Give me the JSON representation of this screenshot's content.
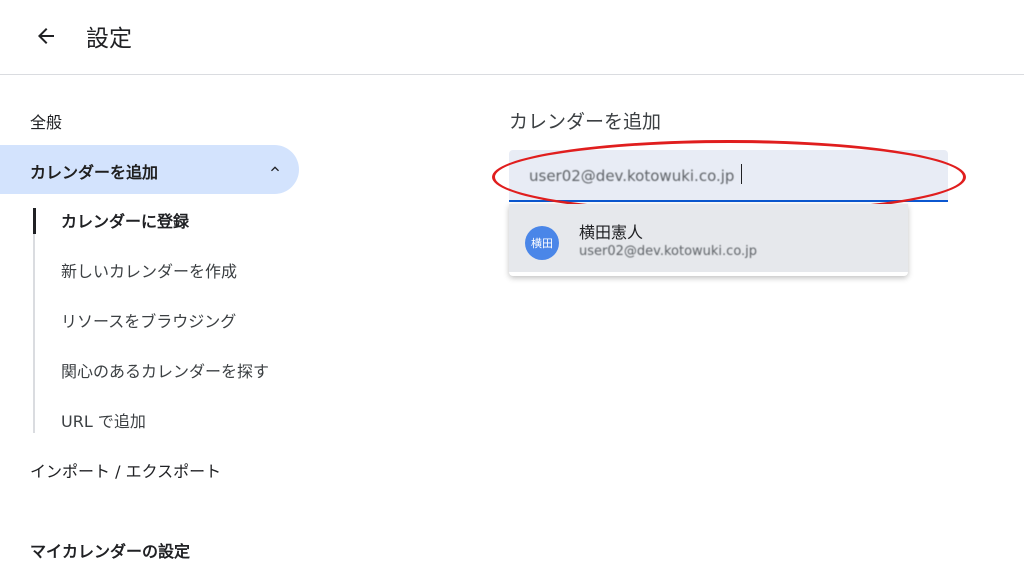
{
  "header": {
    "title": "設定",
    "back_icon": "arrow-back-icon"
  },
  "sidebar": {
    "general": "全般",
    "add_calendar": {
      "label": "カレンダーを追加",
      "expanded": true,
      "sub_items": [
        {
          "label": "カレンダーに登録",
          "active": true
        },
        {
          "label": "新しいカレンダーを作成",
          "active": false
        },
        {
          "label": "リソースをブラウジング",
          "active": false
        },
        {
          "label": "関心のあるカレンダーを探す",
          "active": false
        },
        {
          "label": "URL で追加",
          "active": false
        }
      ]
    },
    "import_export": "インポート / エクスポート",
    "my_calendars_heading": "マイカレンダーの設定"
  },
  "main": {
    "title": "カレンダーを追加",
    "search": {
      "value": "user02@dev.kotowuki.co.jp"
    },
    "suggestions": [
      {
        "avatar_text": "横田",
        "name": "横田憲人",
        "email": "user02@dev.kotowuki.co.jp"
      }
    ]
  },
  "colors": {
    "accent": "#0b57d0",
    "selected_bg": "#d3e3fd",
    "highlight_oval": "#e01e1e",
    "avatar_bg": "#4a86e8"
  }
}
